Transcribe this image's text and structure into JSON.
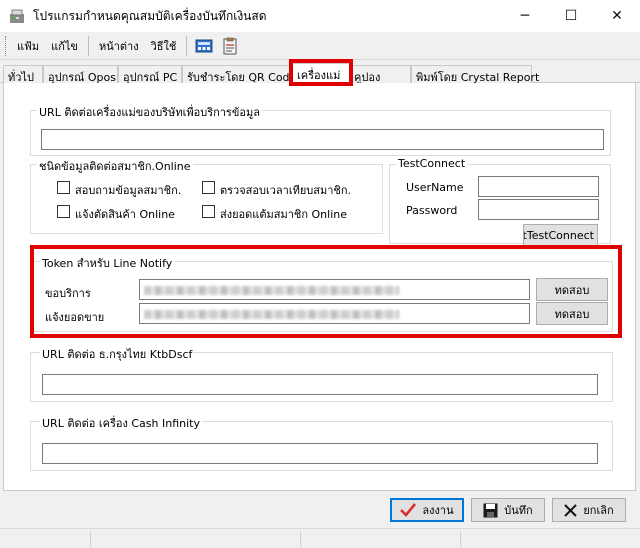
{
  "window": {
    "title": "โปรแกรมกำหนดคุณสมบัติเครื่องบันทึกเงินสด",
    "controls": {
      "minimize": "─",
      "maximize": "☐",
      "close": "✕"
    }
  },
  "menu": {
    "items": [
      "แฟ้ม",
      "แก้ไข",
      "หน้าต่าง",
      "วิธีใช้"
    ]
  },
  "tabs": [
    "ทั่วไป",
    "อุปกรณ์ Opos",
    "อุปกรณ์ PC",
    "รับชำระโดย QR Code",
    "เครื่องแม่",
    "คูปอง",
    "พิมพ์โดย Crystal Report"
  ],
  "active_tab": "เครื่องแม่",
  "url_company": {
    "label": "URL ติดต่อเครื่องแม่ของบริษัทเพื่อบริการข้อมูล",
    "value": ""
  },
  "member_online": {
    "label": "ชนิดข้อมูลติดต่อสมาชิก.Online",
    "options": [
      {
        "label": "สอบถามข้อมูลสมาชิก.",
        "checked": false
      },
      {
        "label": "ตรวจสอบเวลาเทียบสมาชิก.",
        "checked": false
      },
      {
        "label": "แจ้งตัดสินค้า Online",
        "checked": false
      },
      {
        "label": "ส่งยอดแต้มสมาชิก Online",
        "checked": false
      }
    ]
  },
  "test_connect": {
    "label": "TestConnect",
    "username_label": "UserName",
    "username_value": "",
    "password_label": "Password",
    "password_value": "",
    "button": "btTestConnect"
  },
  "line_notify": {
    "label": "Token สำหรับ Line Notify",
    "rows": [
      {
        "label": "ขอบริการ",
        "button": "ทดสอบ"
      },
      {
        "label": "แจ้งยอดขาย",
        "button": "ทดสอบ"
      }
    ]
  },
  "url_ktb": {
    "label": "URL ติดต่อ ธ.กรุงไทย KtbDscf",
    "value": ""
  },
  "url_cash": {
    "label": "URL ติดต่อ เครื่อง Cash Infinity",
    "value": ""
  },
  "footer": {
    "ok": "ลงงาน",
    "save": "บันทึก",
    "cancel": "ยกเลิก"
  },
  "colors": {
    "highlight": "#e00000",
    "focus": "#0078d7"
  }
}
